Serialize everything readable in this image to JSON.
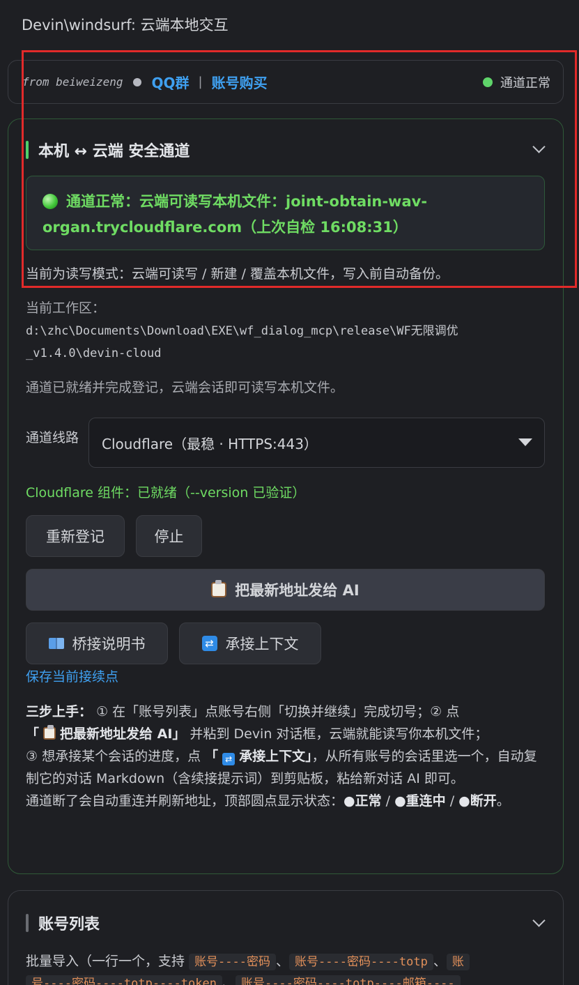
{
  "app": {
    "title": "Devin\\windsurf: 云端本地交互"
  },
  "topbar": {
    "from": "from beiweizeng",
    "qq_link": "QQ群",
    "sep": "|",
    "buy_link": "账号购买",
    "status": "通道正常",
    "status_color": "#5fd46a"
  },
  "tunnel_panel": {
    "title": "本机 ↔ 云端 安全通道",
    "alert": "通道正常：云端可读写本机文件：joint-obtain-wav-organ.trycloudflare.com（上次自检 16:08:31）",
    "mode_text": "当前为读写模式：云端可读写 / 新建 / 覆盖本机文件，写入前自动备份。",
    "workspace_label": "当前工作区：",
    "workspace_path_1": "d:\\zhc\\Documents\\Download\\EXE\\wf_dialog_mcp\\release\\WF无限调优",
    "workspace_path_2": "_v1.4.0\\devin-cloud",
    "ready_text": "通道已就绪并完成登记，云端会话即可读写本机文件。",
    "route_label": "通道线路",
    "route_value": "Cloudflare（最稳 · HTTPS:443）",
    "component_status": "Cloudflare 组件：已就绪（--version 已验证）",
    "btn_reregister": "重新登记",
    "btn_stop": "停止",
    "btn_send_latest": "把最新地址发给 AI",
    "btn_manual": "桥接说明书",
    "btn_context": "承接上下文",
    "save_link": "保存当前接续点",
    "help_steps_label": "三步上手：",
    "help_1": "① 在「账号列表」点账号右侧「切换并继续」完成切号；② 点",
    "help_2a": "「",
    "help_2b": "把最新地址发给 AI」",
    "help_2c": "并粘到 Devin 对话框，云端就能读写你本机文件；",
    "help_3a": "③ 想承接某个会话的进度，点",
    "help_3b": "「",
    "help_3c": "承接上下文」",
    "help_3d": "，从所有账号的会话里选一个，自动复制它的对话 Markdown（含续接提示词）到剪贴板，粘给新对话 AI 即可。",
    "help_4": "通道断了会自动重连并刷新地址，顶部圆点显示状态：",
    "help_state_ok": "●正常",
    "help_state_reconnect": "●重连中",
    "help_state_down": "●断开",
    "help_end": "。",
    "slash": " / "
  },
  "accounts_panel": {
    "title": "账号列表",
    "import_text": "批量导入（一行一个，支持",
    "fmt_1": "账号----密码",
    "fmt_2": "账号----密码----totp",
    "fmt_3a": "账",
    "fmt_3b": "号----密码----totp----token",
    "fmt_4": "账号----密码----totp----邮箱----",
    "dun": "、"
  },
  "colors": {
    "accent_green": "#6fdc63",
    "link_blue": "#3fa0f0",
    "highlight_box": "#e12a2a"
  },
  "icons": [
    "chevron-down-icon",
    "clipboard-icon",
    "book-icon",
    "cycle-icon",
    "green-orb-icon"
  ]
}
